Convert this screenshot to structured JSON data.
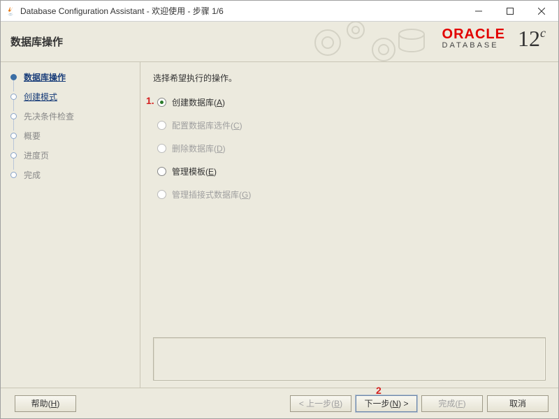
{
  "titlebar": {
    "title": "Database Configuration Assistant - 欢迎使用 - 步骤 1/6"
  },
  "header": {
    "heading": "数据库操作",
    "logo_brand": "ORACLE",
    "logo_sub": "DATABASE",
    "logo_version_main": "12",
    "logo_version_sup": "c"
  },
  "sidebar": {
    "steps": [
      {
        "label": "数据库操作"
      },
      {
        "label": "创建模式"
      },
      {
        "label": "先决条件检查"
      },
      {
        "label": "概要"
      },
      {
        "label": "进度页"
      },
      {
        "label": "完成"
      }
    ]
  },
  "content": {
    "prompt": "选择希望执行的操作。",
    "options": {
      "create_db": {
        "pre": "创建数据库(",
        "m": "A",
        "post": ")"
      },
      "configure": {
        "pre": "配置数据库选件(",
        "m": "C",
        "post": ")"
      },
      "delete_db": {
        "pre": "删除数据库(",
        "m": "D",
        "post": ")"
      },
      "manage_tpl": {
        "pre": "管理模板(",
        "m": "E",
        "post": ")"
      },
      "manage_pdb": {
        "pre": "管理插接式数据库(",
        "m": "G",
        "post": ")"
      }
    },
    "annotations": {
      "a1": "1.",
      "a2": "2"
    }
  },
  "footer": {
    "help": {
      "pre": "帮助(",
      "m": "H",
      "post": ")"
    },
    "back": {
      "pre": "< 上一步(",
      "m": "B",
      "post": ")"
    },
    "next": {
      "pre": "下一步(",
      "m": "N",
      "post": ") >"
    },
    "finish": {
      "pre": "完成(",
      "m": "F",
      "post": ")"
    },
    "cancel": {
      "label": "取消"
    }
  }
}
